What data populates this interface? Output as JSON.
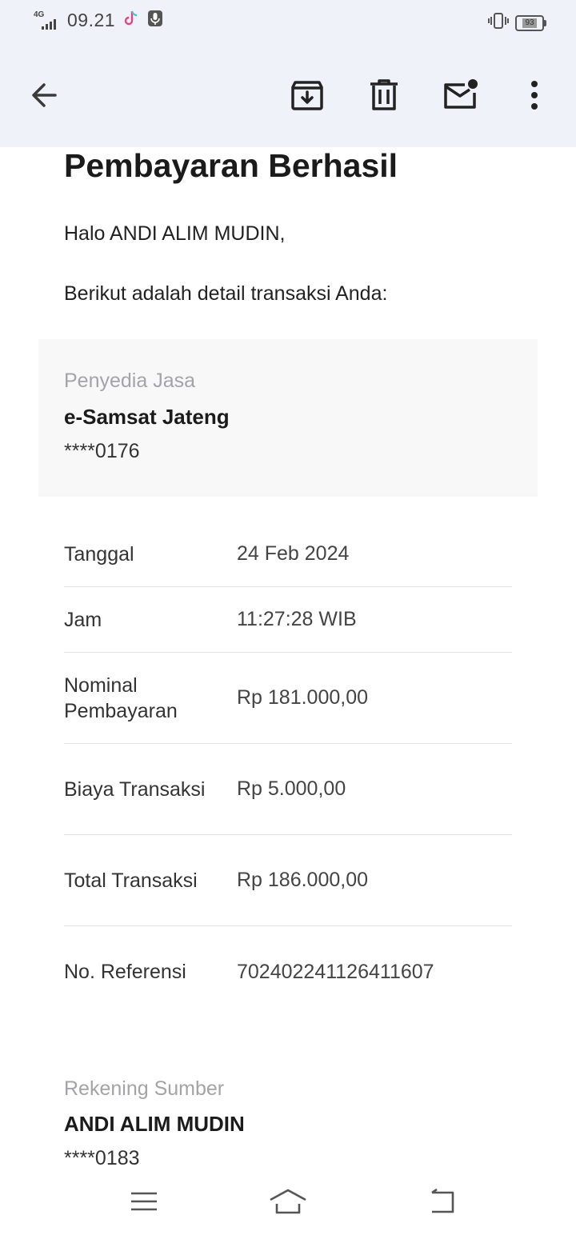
{
  "status_bar": {
    "network": "4G",
    "time": "09.21",
    "battery": "93"
  },
  "app_bar": {
    "back": "back",
    "archive": "archive",
    "delete": "delete",
    "mark_unread": "mark unread",
    "more": "more options"
  },
  "email": {
    "title": "Pembayaran Berhasil",
    "greeting": "Halo ANDI ALIM MUDIN,",
    "intro": "Berikut adalah detail transaksi Anda:",
    "provider": {
      "label": "Penyedia Jasa",
      "name": "e-Samsat Jateng",
      "account": "****0176"
    },
    "details": [
      {
        "key": "Tanggal",
        "value": "24 Feb 2024"
      },
      {
        "key": "Jam",
        "value": "11:27:28 WIB"
      },
      {
        "key": "Nominal Pembayaran",
        "value": "Rp 181.000,00"
      },
      {
        "key": "Biaya Transaksi",
        "value": "Rp 5.000,00"
      },
      {
        "key": "Total Transaksi",
        "value": "Rp 186.000,00"
      },
      {
        "key": "No. Referensi",
        "value": "702402241126411607"
      }
    ],
    "source": {
      "label": "Rekening Sumber",
      "name": "ANDI ALIM MUDIN",
      "account": "****0183"
    }
  },
  "nav_bar": {
    "menu": "menu",
    "home": "home",
    "back": "back"
  }
}
